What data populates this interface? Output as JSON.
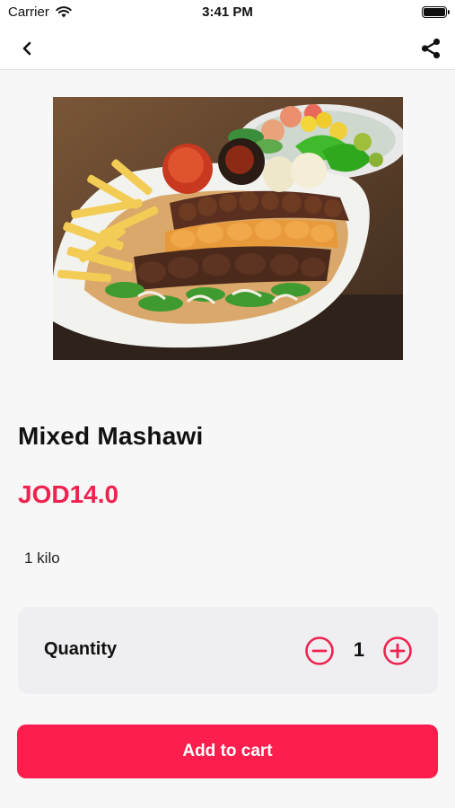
{
  "status_bar": {
    "carrier": "Carrier",
    "time": "3:41 PM"
  },
  "nav": {
    "back_icon": "chevron-left-icon",
    "share_icon": "share-icon"
  },
  "product": {
    "name": "Mixed Mashawi",
    "price": "JOD14.0",
    "description": "1 kilo",
    "image_icon": "food-photo"
  },
  "quantity": {
    "label": "Quantity",
    "value": "1",
    "minus_icon": "minus-circle-icon",
    "plus_icon": "plus-circle-icon"
  },
  "cart": {
    "button_label": "Add to cart"
  },
  "colors": {
    "accent": "#fd1e4d",
    "price": "#f0224f",
    "card_bg": "#efeff1",
    "background": "#f7f7f7"
  }
}
